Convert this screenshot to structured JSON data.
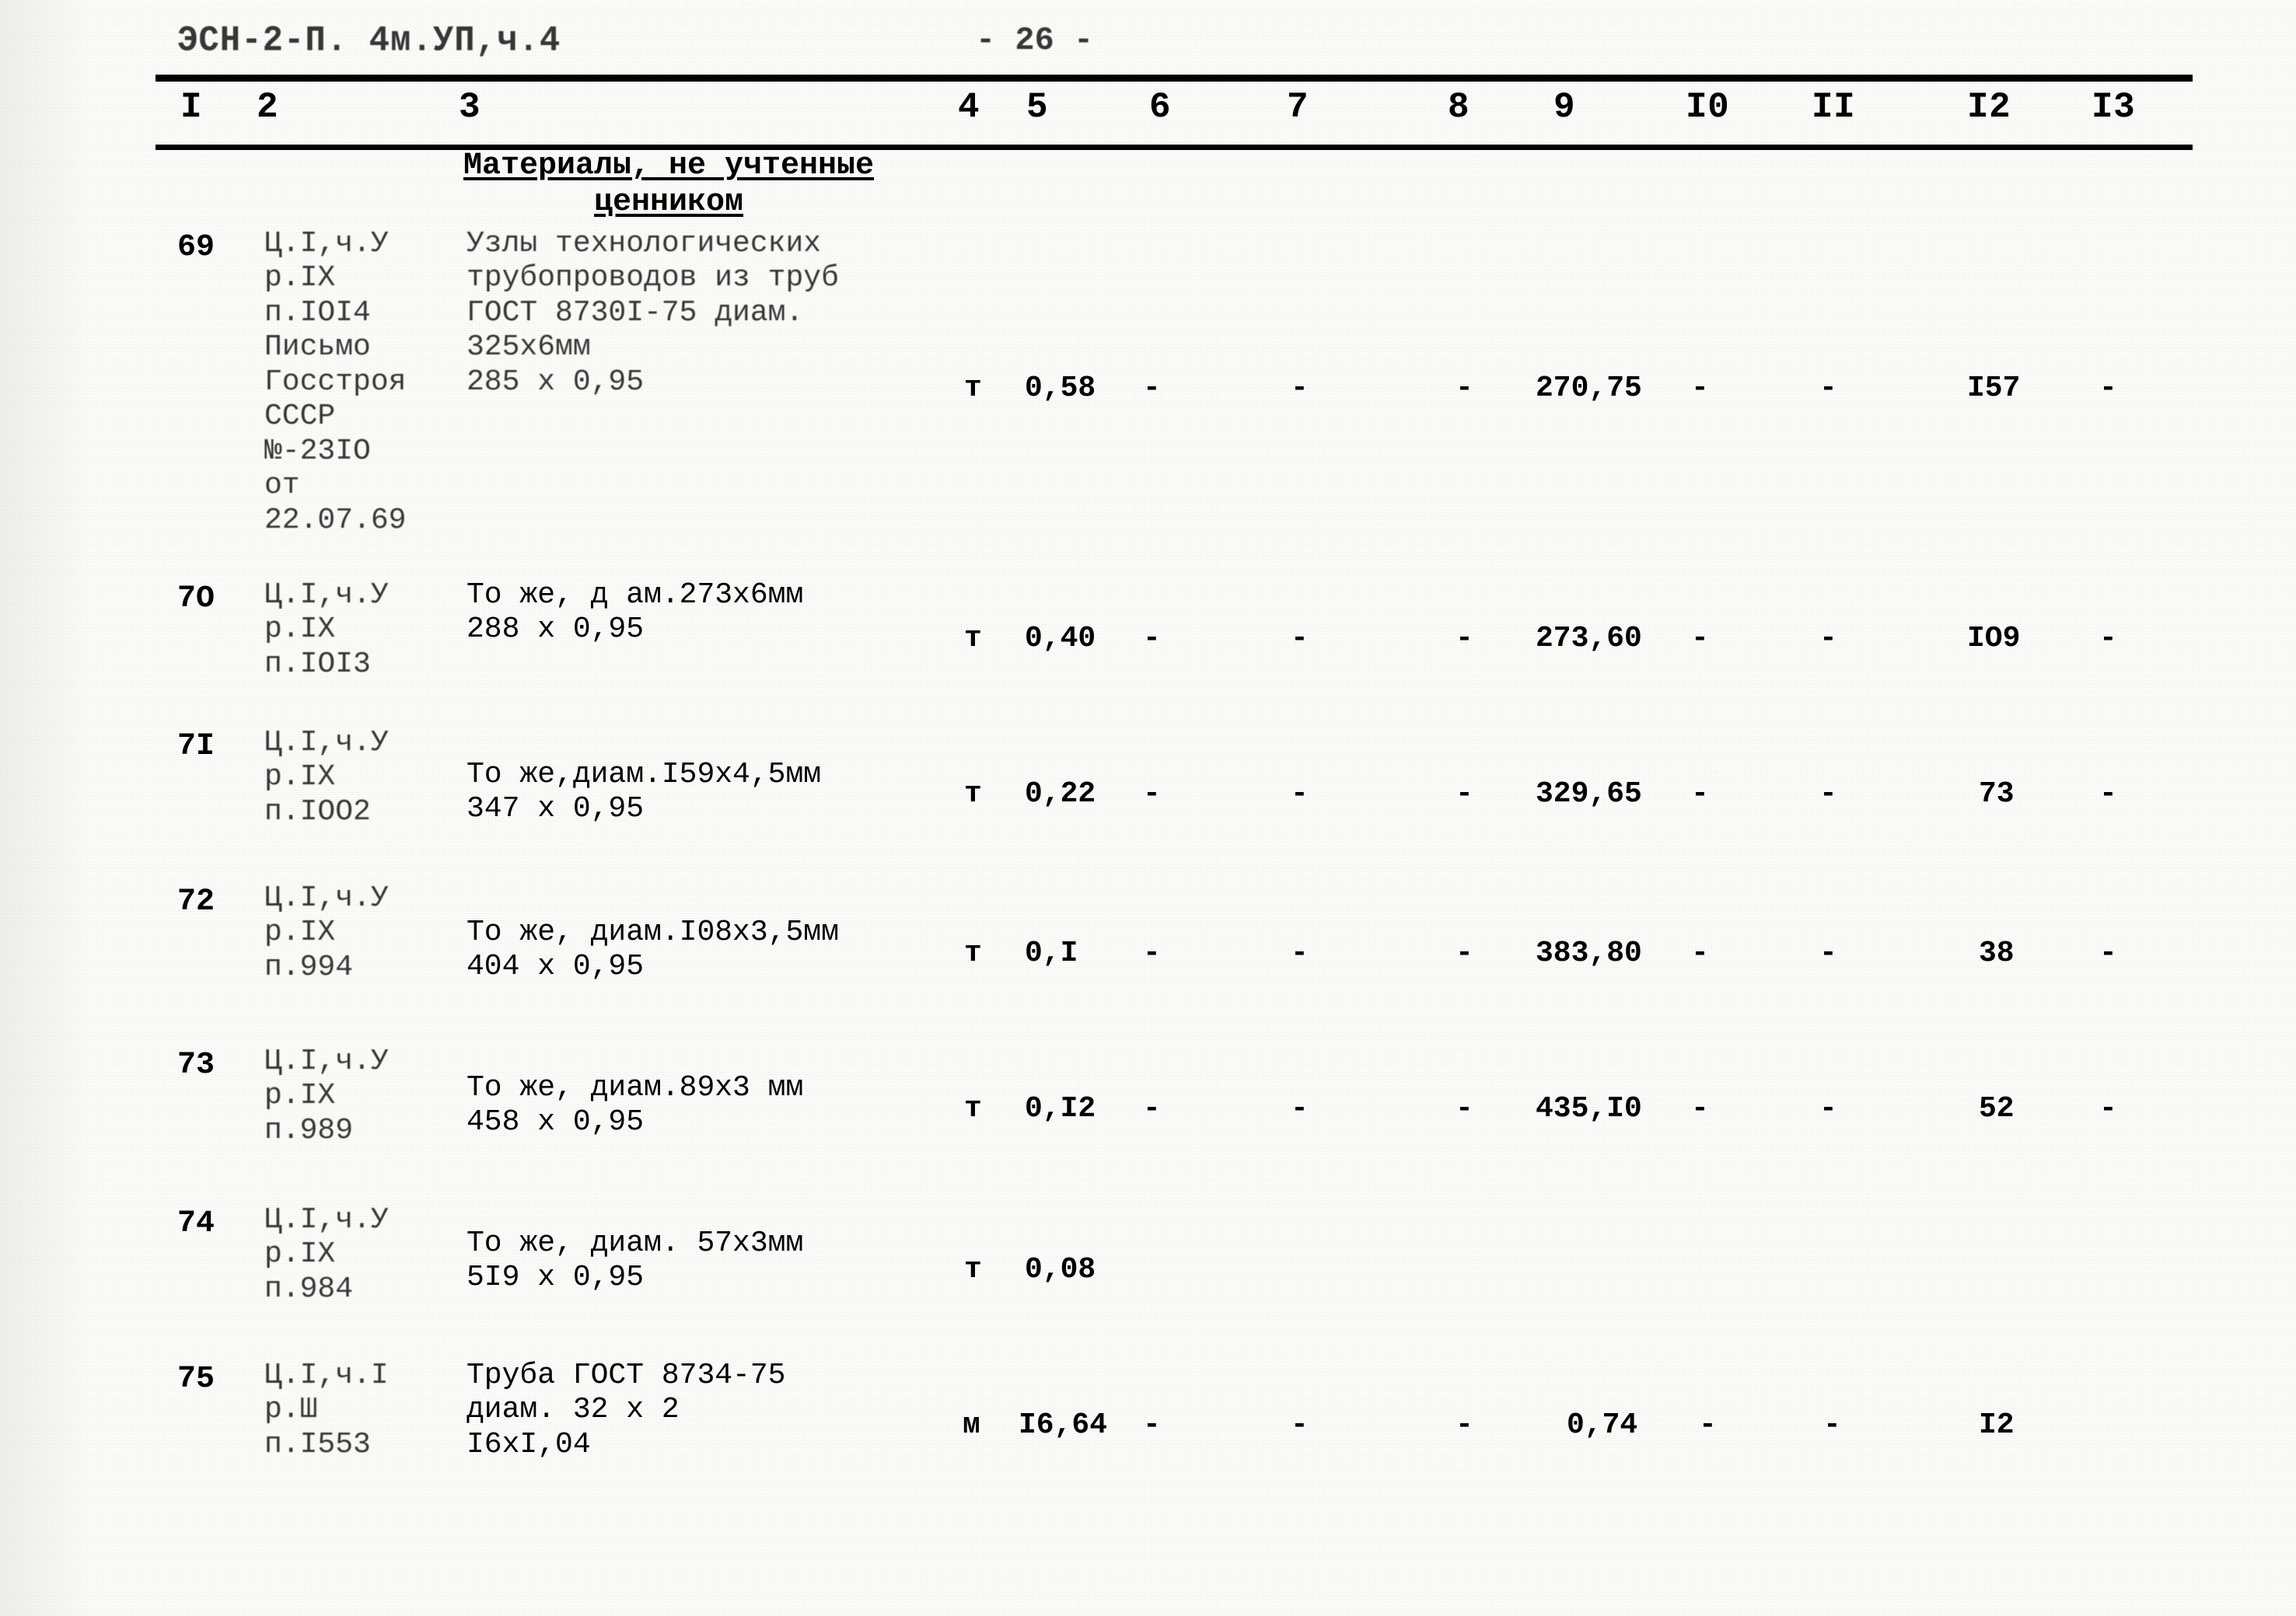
{
  "document": {
    "header_code": "ЭСН-2-П. 4м.УП,ч.4",
    "page_number": "- 26 -",
    "section_title_line1": "Материалы, не учтенные",
    "section_title_line2": "ценником"
  },
  "table": {
    "column_headers": [
      "I",
      "2",
      "3",
      "4",
      "5",
      "6",
      "7",
      "8",
      "9",
      "I0",
      "II",
      "I2",
      "I3"
    ],
    "rows": [
      {
        "num": "69",
        "code": "Ц.I,ч.У\nр.IX\nп.IOI4\nПисьмо\nГосстроя\nСССР\n№-23IO\nот\n22.07.69",
        "desc": "Узлы технологических\nтрубопроводов из труб\nГОСТ 8730I-75 диам.\n325х6мм\n285 х 0,95",
        "c4": "т",
        "c5": "0,58",
        "c6": "-",
        "c7": "-",
        "c8": "-",
        "c9": "270,75",
        "c10": "-",
        "c11": "-",
        "c12": "I57",
        "c13": "-"
      },
      {
        "num": "7О",
        "code": "Ц.I,ч.У\nр.IX\nп.IOI3",
        "desc": "То же, д ам.273х6мм\n288 х 0,95",
        "c4": "т",
        "c5": "0,40",
        "c6": "-",
        "c7": "-",
        "c8": "-",
        "c9": "273,60",
        "c10": "-",
        "c11": "-",
        "c12": "IО9",
        "c13": "-"
      },
      {
        "num": "7I",
        "code": "Ц.I,ч.У\nр.IX\nп.IOO2",
        "desc": "То же,диам.I59х4,5мм\n347 х 0,95",
        "c4": "т",
        "c5": "0,22",
        "c6": "-",
        "c7": "-",
        "c8": "-",
        "c9": "329,65",
        "c10": "-",
        "c11": "-",
        "c12": "73",
        "c13": "-"
      },
      {
        "num": "72",
        "code": "Ц.I,ч.У\nр.IX\nп.994",
        "desc": "То же, диам.I08х3,5мм\n404 х 0,95",
        "c4": "т",
        "c5": "0,I",
        "c6": "-",
        "c7": "-",
        "c8": "-",
        "c9": "383,80",
        "c10": "-",
        "c11": "-",
        "c12": "38",
        "c13": "-"
      },
      {
        "num": "73",
        "code": "Ц.I,ч.У\nр.IX\nп.989",
        "desc": "То же, диам.89х3 мм\n458 х 0,95",
        "c4": "т",
        "c5": "0,I2",
        "c6": "-",
        "c7": "-",
        "c8": "-",
        "c9": "435,I0",
        "c10": "-",
        "c11": "-",
        "c12": "52",
        "c13": "-"
      },
      {
        "num": "74",
        "code": "Ц.I,ч.У\nр.IX\nп.984",
        "desc": "То же, диам. 57х3мм\n5I9 х 0,95",
        "c4": "т",
        "c5": "0,08",
        "c6": "",
        "c7": "",
        "c8": "",
        "c9": "",
        "c10": "",
        "c11": "",
        "c12": "",
        "c13": ""
      },
      {
        "num": "75",
        "code": "Ц.I,ч.I\nр.Ш\nп.I553",
        "desc": "Труба ГОСТ 8734-75\nдиам. 32 х 2\nI6хI,04",
        "c4": "м",
        "c5": "I6,64",
        "c6": "-",
        "c7": "-",
        "c8": "-",
        "c9": "0,74",
        "c10": "-",
        "c11": "-",
        "c12": "I2",
        "c13": ""
      }
    ]
  }
}
